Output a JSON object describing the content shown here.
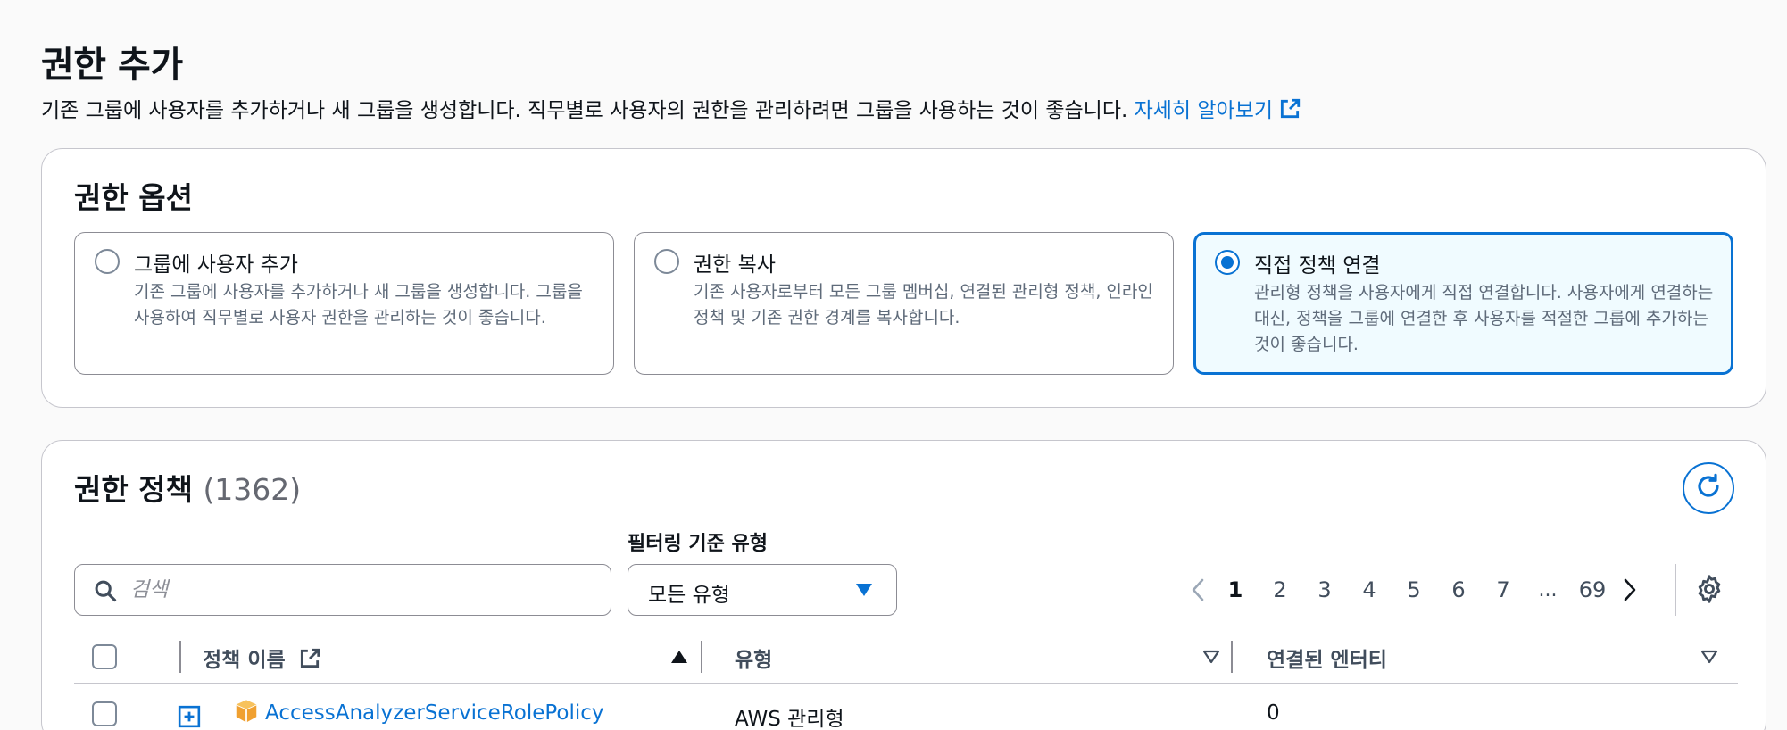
{
  "header": {
    "title": "권한 추가",
    "description": "기존 그룹에 사용자를 추가하거나 새 그룹을 생성합니다. 직무별로 사용자의 권한을 관리하려면 그룹을 사용하는 것이 좋습니다.",
    "learn_more": "자세히 알아보기"
  },
  "options": {
    "title": "권한 옵션",
    "items": [
      {
        "label": "그룹에 사용자 추가",
        "description": "기존 그룹에 사용자를 추가하거나 새 그룹을 생성합니다. 그룹을 사용하여 직무별로 사용자 권한을 관리하는 것이 좋습니다.",
        "selected": false
      },
      {
        "label": "권한 복사",
        "description": "기존 사용자로부터 모든 그룹 멤버십, 연결된 관리형 정책, 인라인 정책 및 기존 권한 경계를 복사합니다.",
        "selected": false
      },
      {
        "label": "직접 정책 연결",
        "description": "관리형 정책을 사용자에게 직접 연결합니다. 사용자에게 연결하는 대신, 정책을 그룹에 연결한 후 사용자를 적절한 그룹에 추가하는 것이 좋습니다.",
        "selected": true
      }
    ]
  },
  "policies": {
    "title": "권한 정책",
    "count": "(1362)",
    "filter_label": "필터링 기준 유형",
    "search_placeholder": "검색",
    "filter_value": "모든 유형",
    "pagination": {
      "pages": [
        "1",
        "2",
        "3",
        "4",
        "5",
        "6",
        "7"
      ],
      "ellipsis": "...",
      "last_page": "69",
      "current": "1"
    },
    "columns": {
      "name": "정책 이름",
      "type": "유형",
      "attached": "연결된 엔터티"
    },
    "rows": [
      {
        "name": "AccessAnalyzerServiceRolePolicy",
        "type": "AWS 관리형",
        "attached": "0"
      }
    ]
  },
  "colors": {
    "accent": "#0972d3",
    "selected_bg": "#f0fbff",
    "aws_orange": "#f0a030"
  }
}
